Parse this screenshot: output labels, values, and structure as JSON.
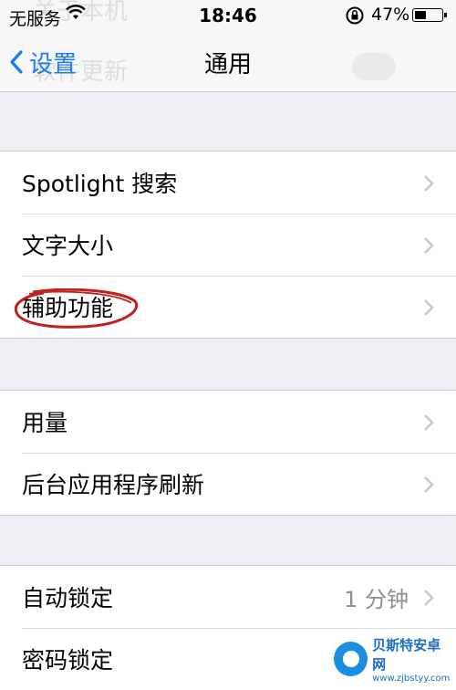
{
  "status_bar": {
    "carrier": "无服务",
    "time": "18:46",
    "battery_percent": "47%",
    "battery_level": 0.47
  },
  "nav": {
    "back_label": "设置",
    "title": "通用",
    "ghost_text_1": "关于本机",
    "ghost_text_2": "软件更新"
  },
  "group1": [
    {
      "label": "Spotlight 搜索"
    },
    {
      "label": "文字大小"
    },
    {
      "label": "辅助功能"
    }
  ],
  "group2": [
    {
      "label": "用量"
    },
    {
      "label": "后台应用程序刷新"
    }
  ],
  "group3": [
    {
      "label": "自动锁定",
      "value": "1 分钟"
    },
    {
      "label": "密码锁定"
    }
  ],
  "annotation": {
    "color": "#c0201e"
  },
  "accent_color": "#1a7cf5",
  "watermark": {
    "line1": "贝斯特安卓网",
    "line2": "www.zjbstyy.com"
  }
}
